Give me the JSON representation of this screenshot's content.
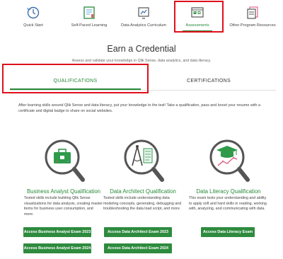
{
  "nav": {
    "items": [
      {
        "label": "Quick Start",
        "icon": "clock-icon"
      },
      {
        "label": "Self-Paced Learning",
        "icon": "book-icon"
      },
      {
        "label": "Data Analytics Curriculum",
        "icon": "chart-screen-icon"
      },
      {
        "label": "Assessments",
        "icon": "checklist-icon"
      },
      {
        "label": "Other Program Resources",
        "icon": "documents-icon"
      }
    ],
    "active_index": 3
  },
  "headline": "Earn a Credential",
  "subhead": "Assess and validate your knowledge in Qlik Sense, data analytics, and data literacy.",
  "tabs": {
    "qualifications": "QUALIFICATIONS",
    "certifications": "CERTIFICATIONS"
  },
  "intro": "After learning skills around Qlik Sense and data literacy, put your knowledge to the test! Take a qualification, pass and boost your resume with a certificate and digital badge to share on social websites.",
  "cards": [
    {
      "title": "Business Analyst Qualification",
      "icon": "briefcase-magnifier-icon",
      "desc": "Tested skills include building Qlik Sense visualizations for data analysis, creating master items for business user consumption, and more.",
      "buttons": [
        "Access Business Analyst Exam 2023",
        "Access Business Analyst Exam 2024"
      ]
    },
    {
      "title": "Data Architect Qualification",
      "icon": "compass-magnifier-icon",
      "desc": "Tested skills include understanding data modeling concepts, generating, debugging and troubleshooting the data load script, and more.",
      "buttons": [
        "Access Data Architect Exam 2023",
        "Access Data Architect Exam 2024"
      ]
    },
    {
      "title": "Data Literacy Qualification",
      "icon": "graduation-chart-magnifier-icon",
      "desc": "This exam tests your understanding and ability to apply soft and hard skills in reading, working with, analyzing, and communicating with data.",
      "buttons": [
        "Access Data Literacy Exam"
      ]
    }
  ],
  "colors": {
    "accent": "#2a8a3a",
    "button": "#2e8b3e",
    "highlight": "#e0101c"
  }
}
